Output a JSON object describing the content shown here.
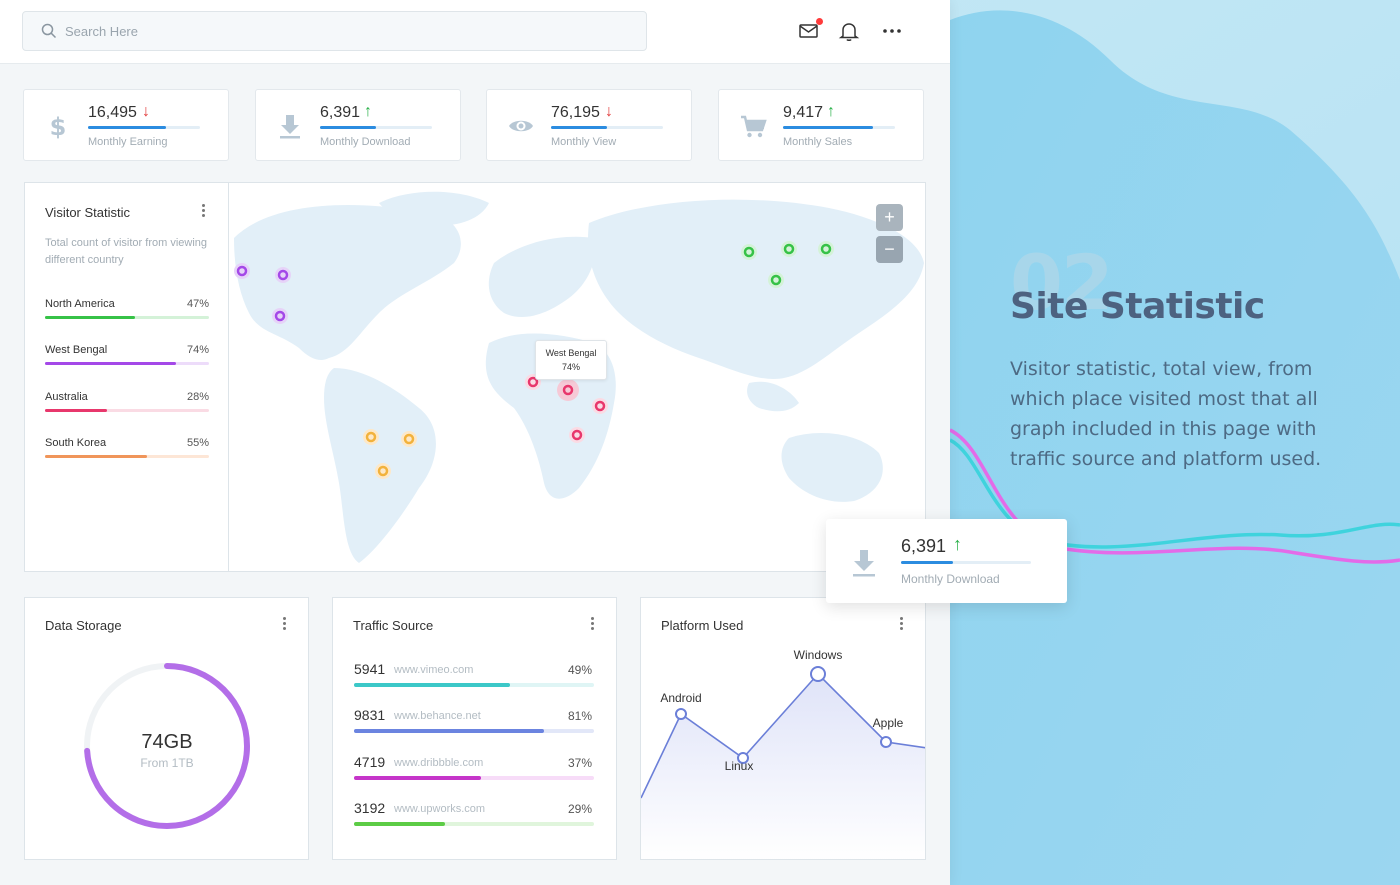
{
  "search": {
    "placeholder": "Search Here"
  },
  "header": {
    "icons": [
      "mail-icon",
      "bell-icon",
      "more-icon"
    ],
    "mail_has_notification": true
  },
  "stats": [
    {
      "value": "16,495",
      "trend": "down",
      "arrow": "↓",
      "label": "Monthly Earning",
      "icon": "dollar-icon",
      "progress": 0.7
    },
    {
      "value": "6,391",
      "trend": "up",
      "arrow": "↑",
      "label": "Monthly Download",
      "icon": "download-icon",
      "progress": 0.5
    },
    {
      "value": "76,195",
      "trend": "down",
      "arrow": "↓",
      "label": "Monthly View",
      "icon": "eye-icon",
      "progress": 0.5
    },
    {
      "value": "9,417",
      "trend": "up",
      "arrow": "↑",
      "label": "Monthly Sales",
      "icon": "cart-icon",
      "progress": 0.8
    }
  ],
  "visitor": {
    "title": "Visitor Statistic",
    "subtitle": "Total count of visitor from viewing different country",
    "countries": [
      {
        "name": "North America",
        "pct": "47%",
        "value": 0.55,
        "color": "#36c247",
        "track": "#d4f2d8"
      },
      {
        "name": "West Bengal",
        "pct": "74%",
        "value": 0.8,
        "color": "#a448e8",
        "track": "#eddcfa"
      },
      {
        "name": "Australia",
        "pct": "28%",
        "value": 0.38,
        "color": "#e8376c",
        "track": "#fadbe4"
      },
      {
        "name": "South Korea",
        "pct": "55%",
        "value": 0.62,
        "color": "#f0955a",
        "track": "#fde6d6"
      }
    ],
    "tooltip": {
      "name": "West Bengal",
      "pct": "74%"
    },
    "zoom_in": "+",
    "zoom_out": "−"
  },
  "storage": {
    "title": "Data Storage",
    "value": "74GB",
    "sub": "From 1TB",
    "fraction": 0.74,
    "color": "#b36ee8"
  },
  "traffic": {
    "title": "Traffic Source",
    "rows": [
      {
        "num": "5941",
        "site": "www.vimeo.com",
        "pct": "49%",
        "value": 0.65,
        "color": "#3cc8c8",
        "track": "#dff5f5"
      },
      {
        "num": "9831",
        "site": "www.behance.net",
        "pct": "81%",
        "value": 0.79,
        "color": "#6b84e0",
        "track": "#e2e7f8"
      },
      {
        "num": "4719",
        "site": "www.dribbble.com",
        "pct": "37%",
        "value": 0.53,
        "color": "#c535c9",
        "track": "#f7dcf8"
      },
      {
        "num": "3192",
        "site": "www.upworks.com",
        "pct": "29%",
        "value": 0.38,
        "color": "#5ccc45",
        "track": "#e0f5dc"
      }
    ]
  },
  "platform": {
    "title": "Platform Used",
    "chart_data": {
      "type": "line",
      "categories": [
        "Android",
        "Linux",
        "Windows",
        "Apple"
      ],
      "values": [
        62,
        40,
        82,
        48
      ]
    }
  },
  "float_card": {
    "value": "6,391",
    "arrow": "↑",
    "label": "Monthly Download",
    "progress": 0.4
  },
  "promo": {
    "number": "02",
    "title": "Site Statistic",
    "description": "Visitor statistic, total view, from which place visited most that all graph included in this page with traffic source and platform used."
  }
}
